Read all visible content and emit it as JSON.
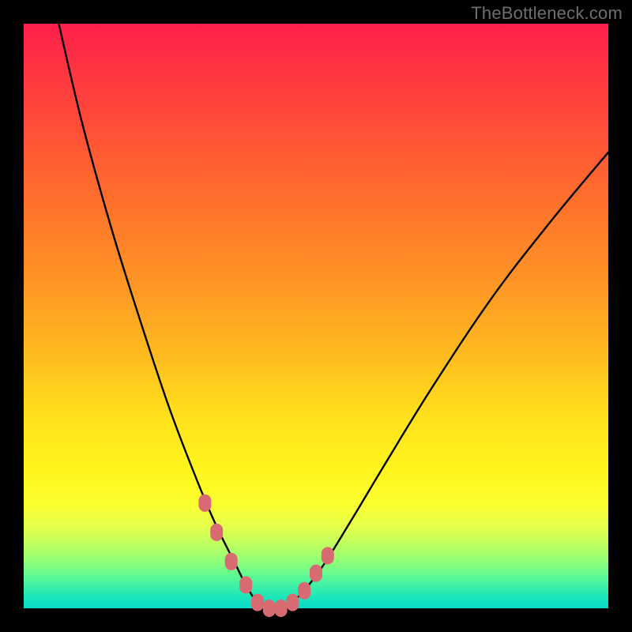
{
  "watermark": "TheBottleneck.com",
  "colors": {
    "frame": "#000000",
    "gradient_top": "#ff1f4b",
    "gradient_bottom": "#07d9c9",
    "curve": "#000000",
    "marker": "#d86a72"
  },
  "chart_data": {
    "type": "line",
    "title": "",
    "xlabel": "",
    "ylabel": "",
    "xlim": [
      0,
      100
    ],
    "ylim": [
      0,
      100
    ],
    "annotations": [],
    "series": [
      {
        "name": "bottleneck-curve",
        "x": [
          6,
          10,
          15,
          20,
          25,
          30,
          33,
          36,
          38,
          40,
          42,
          44,
          47,
          51,
          56,
          62,
          70,
          80,
          90,
          100
        ],
        "values": [
          100,
          83,
          65,
          49,
          34,
          21,
          14,
          8,
          4,
          1,
          0,
          0,
          2,
          7,
          15,
          25,
          38,
          53,
          66,
          78
        ]
      },
      {
        "name": "markers",
        "x": [
          31,
          33,
          35.5,
          38,
          40,
          42,
          44,
          46,
          48,
          50,
          52
        ],
        "values": [
          18,
          13,
          8,
          4,
          1,
          0,
          0,
          1,
          3,
          6,
          9
        ]
      }
    ]
  }
}
